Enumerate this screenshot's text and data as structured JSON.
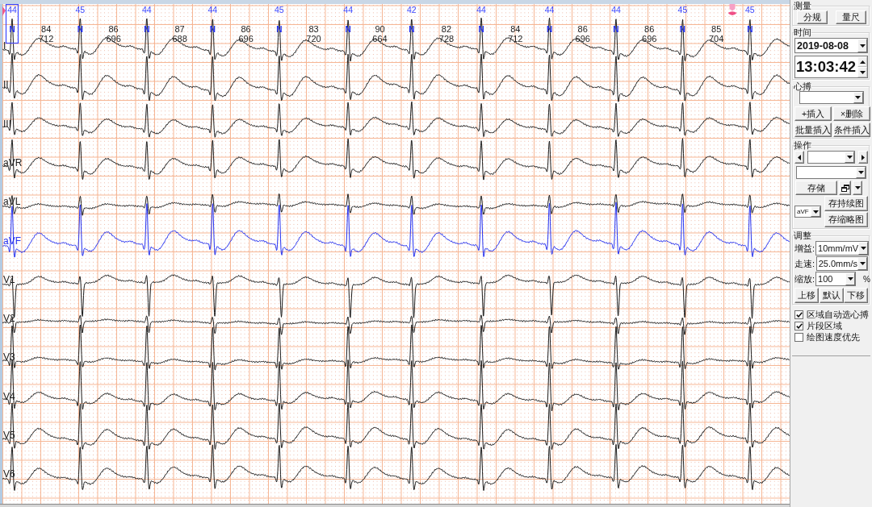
{
  "ecg": {
    "beats": [
      {
        "label": "44",
        "type": "N",
        "selected": true
      },
      {
        "label": "45",
        "type": "N",
        "selected": false
      },
      {
        "label": "44",
        "type": "N",
        "selected": false
      },
      {
        "label": "44",
        "type": "N",
        "selected": false
      },
      {
        "label": "45",
        "type": "N",
        "selected": false
      },
      {
        "label": "44",
        "type": "N",
        "selected": false
      },
      {
        "label": "42",
        "type": "N",
        "selected": false
      },
      {
        "label": "44",
        "type": "N",
        "selected": false
      },
      {
        "label": "44",
        "type": "N",
        "selected": false
      },
      {
        "label": "44",
        "type": "N",
        "selected": false
      },
      {
        "label": "45",
        "type": "N",
        "selected": false
      },
      {
        "label": "45",
        "type": "N",
        "selected": false
      }
    ],
    "intervals": [
      {
        "hr": "84",
        "rr": "712"
      },
      {
        "hr": "86",
        "rr": "696"
      },
      {
        "hr": "87",
        "rr": "688"
      },
      {
        "hr": "86",
        "rr": "696"
      },
      {
        "hr": "83",
        "rr": "720"
      },
      {
        "hr": "90",
        "rr": "664"
      },
      {
        "hr": "82",
        "rr": "728"
      },
      {
        "hr": "84",
        "rr": "712"
      },
      {
        "hr": "86",
        "rr": "696"
      },
      {
        "hr": "86",
        "rr": "696"
      },
      {
        "hr": "85",
        "rr": "704"
      }
    ],
    "leads": [
      {
        "name": "I",
        "selected": false
      },
      {
        "name": "II",
        "selected": false
      },
      {
        "name": "III",
        "selected": false
      },
      {
        "name": "aVR",
        "selected": false
      },
      {
        "name": "aVL",
        "selected": false
      },
      {
        "name": "aVF",
        "selected": true
      },
      {
        "name": "V1",
        "selected": false
      },
      {
        "name": "V2",
        "selected": false
      },
      {
        "name": "V3",
        "selected": false
      },
      {
        "name": "V4",
        "selected": false
      },
      {
        "name": "V5",
        "selected": false
      },
      {
        "name": "V6",
        "selected": false
      }
    ]
  },
  "panel": {
    "measure": {
      "title": "测量",
      "buttons": [
        "分规",
        "量尺"
      ]
    },
    "time": {
      "title": "时间",
      "date": "2019-08-08",
      "time": "13:03:42"
    },
    "beat": {
      "title": "心搏",
      "buttons": [
        "+插入",
        "×删除",
        "批量插入",
        "条件插入"
      ]
    },
    "operation": {
      "title": "操作",
      "save_button": "存储",
      "lead": "aVF",
      "buttons": [
        "存持续图",
        "存缩略图"
      ]
    },
    "adjust": {
      "title": "调整",
      "fields": [
        {
          "label": "增益:",
          "value": "10mm/mV"
        },
        {
          "label": "走速:",
          "value": "25.0mm/s"
        },
        {
          "label": "缩放:",
          "value": "100",
          "unit": "%"
        }
      ],
      "buttons": [
        "上移",
        "默认",
        "下移"
      ]
    },
    "options": [
      {
        "label": "区域自动选心搏",
        "checked": true
      },
      {
        "label": "片段区域",
        "checked": true
      },
      {
        "label": "绘图速度优先",
        "checked": false
      }
    ]
  }
}
